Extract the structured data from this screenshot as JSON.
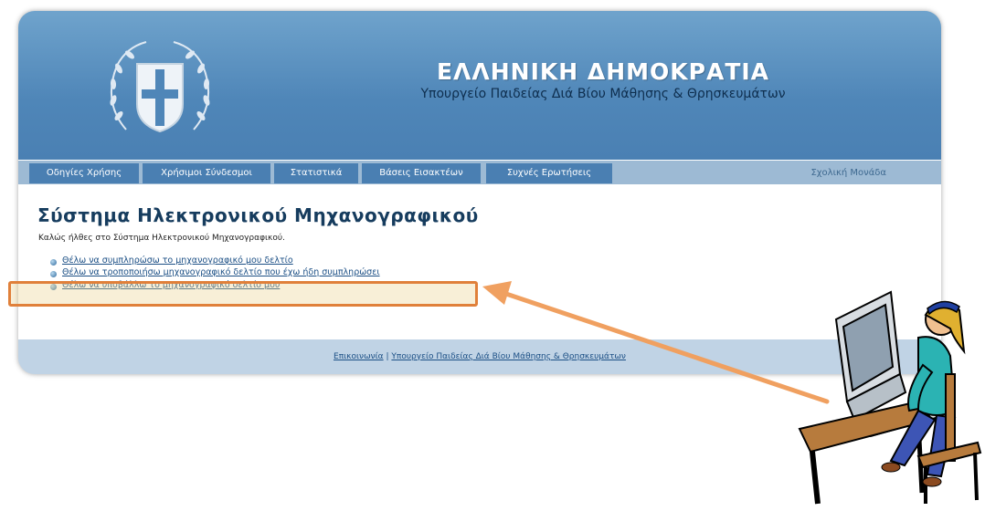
{
  "header": {
    "title": "ΕΛΛΗΝΙΚΗ ΔΗΜΟΚΡΑΤΙΑ",
    "subtitle": "Υπουργείο Παιδείας Διά Βίου Μάθησης & Θρησκευμάτων"
  },
  "nav": {
    "tabs": [
      {
        "label": "Οδηγίες Χρήσης"
      },
      {
        "label": "Χρήσιμοι Σύνδεσμοι"
      },
      {
        "label": "Στατιστικά"
      },
      {
        "label": "Βάσεις Εισακτέων"
      },
      {
        "label": "Συχνές Ερωτήσεις"
      }
    ],
    "right_label": "Σχολική Μονάδα"
  },
  "content": {
    "title": "Σύστημα Ηλεκτρονικού Μηχανογραφικού",
    "welcome": "Καλώς ήλθες στο Σύστημα Ηλεκτρονικού Μηχανογραφικού.",
    "options": [
      {
        "label": "Θέλω να συμπληρώσω το μηχανογραφικό μου δελτίο"
      },
      {
        "label": "Θέλω να τροποποιήσω μηχανογραφικό δελτίο που έχω ήδη συμπληρώσει"
      },
      {
        "label": "Θέλω να υποβάλλω το μηχανογραφικό δελτίο μου"
      }
    ]
  },
  "footer": {
    "contact": "Επικοινωνία",
    "separator": "|",
    "ministry": "Υπουργείο Παιδείας Διά Βίου Μάθησης & Θρησκευμάτων"
  },
  "colors": {
    "header": "#4f86b8",
    "nav_tab": "#4a7fb2",
    "highlight": "#e0803a"
  }
}
